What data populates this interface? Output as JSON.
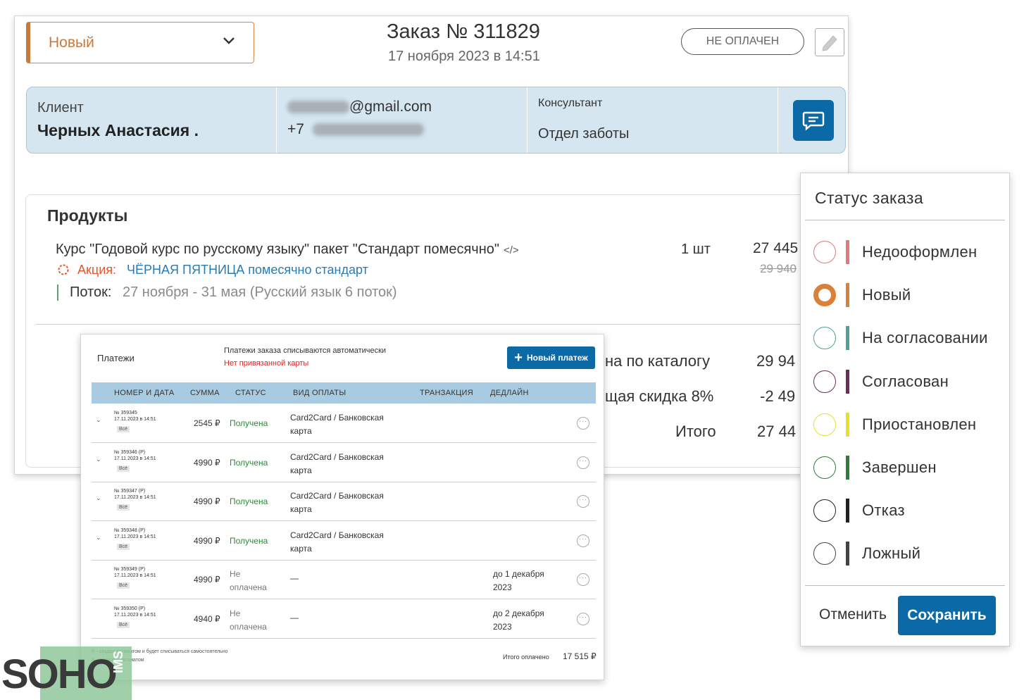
{
  "order": {
    "status_label": "Новый",
    "title": "Заказ № 311829",
    "date": "17 ноября 2023 в 14:51",
    "payment_badge": "НЕ ОПЛАЧЕН"
  },
  "client": {
    "label": "Клиент",
    "name": "Черных Анастасия .",
    "email_suffix": "@gmail.com",
    "phone_prefix": "+7",
    "consultant_label": "Консультант",
    "consultant_value": "Отдел заботы"
  },
  "products": {
    "heading": "Продукты",
    "item": {
      "name": "Курс \"Годовой курс по русскому языку\" пакет \"Стандарт помесячно\"",
      "code_icon": "</>",
      "promo_label": "Акция:",
      "promo_value": "ЧЁРНАЯ ПЯТНИЦА помесячно стандарт",
      "stream_label": "Поток:",
      "stream_value": "27 ноября - 31 мая (Русский язык 6 поток)",
      "qty": "1 шт",
      "price": "27 445",
      "old_price": "29 940"
    },
    "summary": {
      "catalog_label": "на по каталогу",
      "catalog_value": "29 94",
      "discount_label": "щая скидка 8%",
      "discount_value": "-2 49",
      "total_label": "Итого",
      "total_value": "27 44"
    }
  },
  "payments": {
    "title": "Платежи",
    "note": "Платежи заказа списываются автоматически",
    "warning": "Нет привязанной карты",
    "new_button": "Новый платеж",
    "columns": [
      "НОМЕР И ДАТА",
      "СУММА",
      "СТАТУС",
      "ВИД ОПЛАТЫ",
      "ТРАНЗАКЦИЯ",
      "ДЕДЛАЙН"
    ],
    "rows": [
      {
        "num": "№ 359345",
        "date": "17.11.2023 в 14:51",
        "tag": "Всё",
        "amount": "2545 ₽",
        "status": "Получена",
        "method": "Card2Card / Банковская карта",
        "deadline": "",
        "paid": true
      },
      {
        "num": "№ 359346 (P)",
        "date": "17.11.2023 в 14:51",
        "tag": "Всё",
        "amount": "4990 ₽",
        "status": "Получена",
        "method": "Card2Card / Банковская карта",
        "deadline": "",
        "paid": true
      },
      {
        "num": "№ 359347 (P)",
        "date": "17.11.2023 в 14:51",
        "tag": "Всё",
        "amount": "4990 ₽",
        "status": "Получена",
        "method": "Card2Card / Банковская карта",
        "deadline": "",
        "paid": true
      },
      {
        "num": "№ 359348 (P)",
        "date": "17.11.2023 в 14:51",
        "tag": "Всё",
        "amount": "4990 ₽",
        "status": "Получена",
        "method": "Card2Card / Банковская карта",
        "deadline": "",
        "paid": true
      },
      {
        "num": "№ 359349 (P)",
        "date": "17.11.2023 в 14:51",
        "tag": "Всё",
        "amount": "4990 ₽",
        "status": "Не оплачена",
        "method": "—",
        "deadline": "до 1 декабря 2023",
        "paid": false
      },
      {
        "num": "№ 359350 (P)",
        "date": "17.11.2023 в 14:51",
        "tag": "Всё",
        "amount": "4940 ₽",
        "status": "Не оплачена",
        "method": "—",
        "deadline": "до 2 декабря 2023",
        "paid": false
      }
    ],
    "footnote1": "P - создан автоматом и будет списываться самостоятельно",
    "footnote2": "А - оплачен автоматом",
    "total_label": "Итого оплачено",
    "total_value": "17 515 ₽"
  },
  "status_popup": {
    "title": "Статус заказа",
    "options": [
      {
        "label": "Недооформлен",
        "color": "#e07a7a",
        "selected": false
      },
      {
        "label": "Новый",
        "color": "#d9803a",
        "selected": true
      },
      {
        "label": "На согласовании",
        "color": "#4ba39a",
        "selected": false
      },
      {
        "label": "Согласован",
        "color": "#6b2d5c",
        "selected": false
      },
      {
        "label": "Приостановлен",
        "color": "#e9df2a",
        "selected": false
      },
      {
        "label": "Завершен",
        "color": "#2e7d3a",
        "selected": false
      },
      {
        "label": "Отказ",
        "color": "#222222",
        "selected": false
      },
      {
        "label": "Ложный",
        "color": "#444444",
        "selected": false
      }
    ],
    "cancel": "Отменить",
    "save": "Сохранить"
  },
  "logo": {
    "word": "SOHO",
    "suffix": "IMS"
  }
}
